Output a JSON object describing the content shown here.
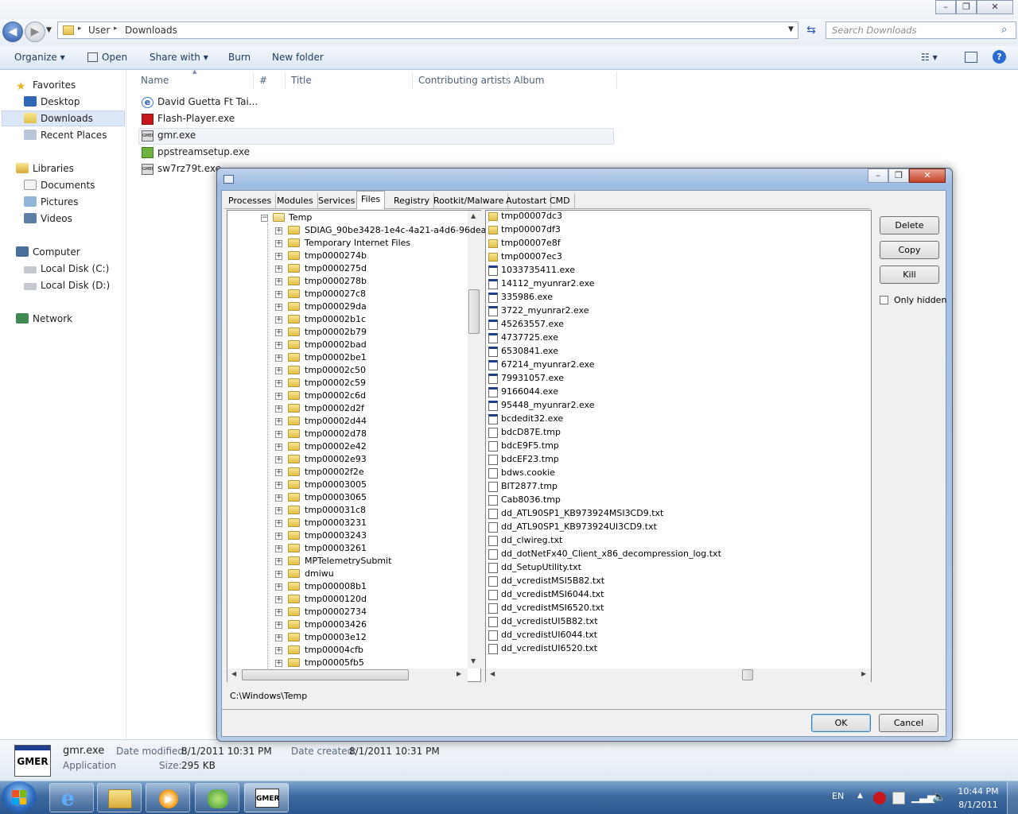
{
  "explorer": {
    "breadcrumb": [
      "User",
      "Downloads"
    ],
    "search_placeholder": "Search Downloads",
    "commands": [
      "Organize",
      "Open",
      "Share with",
      "Burn",
      "New folder"
    ],
    "nav": {
      "favorites": "Favorites",
      "favorites_items": [
        "Desktop",
        "Downloads",
        "Recent Places"
      ],
      "libraries": "Libraries",
      "libraries_items": [
        "Documents",
        "Pictures",
        "Videos"
      ],
      "computer": "Computer",
      "computer_items": [
        "Local Disk (C:)",
        "Local Disk (D:)"
      ],
      "network": "Network"
    },
    "columns": [
      "Name",
      "#",
      "Title",
      "Contributing artists",
      "Album"
    ],
    "files": [
      "David Guetta Ft Tai...",
      "Flash-Player.exe",
      "gmr.exe",
      "ppstreamsetup.exe",
      "sw7rz79t.exe"
    ],
    "details": {
      "name": "gmr.exe",
      "type": "Application",
      "modified_label": "Date modified:",
      "modified": "8/1/2011 10:31 PM",
      "created_label": "Date created:",
      "created": "8/1/2011 10:31 PM",
      "size_label": "Size:",
      "size": "295 KB",
      "icon_text": "GMER"
    }
  },
  "gmer": {
    "tabs": [
      "Processes",
      "Modules",
      "Services",
      "Files",
      "Registry",
      "Rootkit/Malware",
      "Autostart",
      "CMD"
    ],
    "active_tab": "Files",
    "tree_root": "Temp",
    "tree": [
      "SDIAG_90be3428-1e4c-4a21-a4d6-96dea",
      "Temporary Internet Files",
      "tmp0000274b",
      "tmp0000275d",
      "tmp0000278b",
      "tmp000027c8",
      "tmp000029da",
      "tmp00002b1c",
      "tmp00002b79",
      "tmp00002bad",
      "tmp00002be1",
      "tmp00002c50",
      "tmp00002c59",
      "tmp00002c6d",
      "tmp00002d2f",
      "tmp00002d44",
      "tmp00002d78",
      "tmp00002e42",
      "tmp00002e93",
      "tmp00002f2e",
      "tmp00003005",
      "tmp00003065",
      "tmp000031c8",
      "tmp00003231",
      "tmp00003243",
      "tmp00003261",
      "MPTelemetrySubmit",
      "dmiwu",
      "tmp000008b1",
      "tmp0000120d",
      "tmp00002734",
      "tmp00003426",
      "tmp00003e12",
      "tmp00004cfb",
      "tmp00005fb5"
    ],
    "files": [
      {
        "name": "tmp00007dc3",
        "kind": "folder"
      },
      {
        "name": "tmp00007df3",
        "kind": "folder"
      },
      {
        "name": "tmp00007e8f",
        "kind": "folder"
      },
      {
        "name": "tmp00007ec3",
        "kind": "folder"
      },
      {
        "name": "1033735411.exe",
        "kind": "exe"
      },
      {
        "name": "14112_myunrar2.exe",
        "kind": "exe"
      },
      {
        "name": "335986.exe",
        "kind": "exe"
      },
      {
        "name": "3722_myunrar2.exe",
        "kind": "exe"
      },
      {
        "name": "45263557.exe",
        "kind": "exe"
      },
      {
        "name": "4737725.exe",
        "kind": "exe"
      },
      {
        "name": "6530841.exe",
        "kind": "exe"
      },
      {
        "name": "67214_myunrar2.exe",
        "kind": "exe"
      },
      {
        "name": "79931057.exe",
        "kind": "exe"
      },
      {
        "name": "9166044.exe",
        "kind": "exe"
      },
      {
        "name": "95448_myunrar2.exe",
        "kind": "exe"
      },
      {
        "name": "bcdedit32.exe",
        "kind": "exe"
      },
      {
        "name": "bdcD87E.tmp",
        "kind": "file"
      },
      {
        "name": "bdcE9F5.tmp",
        "kind": "file"
      },
      {
        "name": "bdcEF23.tmp",
        "kind": "file"
      },
      {
        "name": "bdws.cookie",
        "kind": "file"
      },
      {
        "name": "BIT2877.tmp",
        "kind": "file"
      },
      {
        "name": "Cab8036.tmp",
        "kind": "file"
      },
      {
        "name": "dd_ATL90SP1_KB973924MSI3CD9.txt",
        "kind": "file"
      },
      {
        "name": "dd_ATL90SP1_KB973924UI3CD9.txt",
        "kind": "file"
      },
      {
        "name": "dd_clwireg.txt",
        "kind": "file"
      },
      {
        "name": "dd_dotNetFx40_Client_x86_decompression_log.txt",
        "kind": "file"
      },
      {
        "name": "dd_SetupUtility.txt",
        "kind": "file"
      },
      {
        "name": "dd_vcredistMSI5B82.txt",
        "kind": "file"
      },
      {
        "name": "dd_vcredistMSI6044.txt",
        "kind": "file"
      },
      {
        "name": "dd_vcredistMSI6520.txt",
        "kind": "file"
      },
      {
        "name": "dd_vcredistUI5B82.txt",
        "kind": "file"
      },
      {
        "name": "dd_vcredistUI6044.txt",
        "kind": "file"
      },
      {
        "name": "dd_vcredistUI6520.txt",
        "kind": "file"
      }
    ],
    "buttons": {
      "delete": "Delete",
      "copy": "Copy",
      "kill": "Kill",
      "only_hidden": "Only hidden",
      "ok": "OK",
      "cancel": "Cancel"
    },
    "path": "C:\\Windows\\Temp"
  },
  "taskbar": {
    "lang": "EN",
    "time": "10:44 PM",
    "date": "8/1/2011",
    "gmer_label": "GMER"
  }
}
